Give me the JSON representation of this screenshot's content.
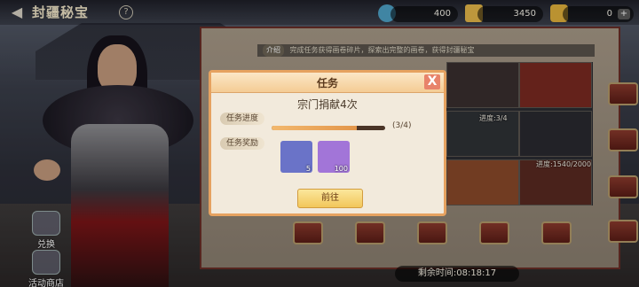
{
  "header": {
    "title": "封疆秘宝",
    "back_icon": "back-arrow-icon",
    "help_label": "?"
  },
  "resources": [
    {
      "name": "silver-coin",
      "value": "400",
      "color": "#4fa3c7"
    },
    {
      "name": "coupon",
      "value": "3450",
      "color": "#e7b94a"
    },
    {
      "name": "gold-ingot",
      "value": "0",
      "color": "#e3b33c",
      "plus": "+"
    }
  ],
  "side_buttons": [
    {
      "label": "兑换",
      "icon": "exchange-icon"
    },
    {
      "label": "活动商店",
      "icon": "shop-icon"
    }
  ],
  "board": {
    "hint_tag": "介绍",
    "hint_text": "完成任务获得画卷碎片，探索出完整的画卷，获得封疆秘宝",
    "progress_a": "进度:3/4",
    "progress_b": "进度:1540/2000",
    "timer": "剩余时间:08:18:17"
  },
  "modal": {
    "title": "任务",
    "task_name": "宗门捐献4次",
    "progress_label": "任务进度",
    "progress_text": "(3/4)",
    "progress_value": 0.75,
    "reward_label": "任务奖励",
    "rewards": [
      {
        "name": "scroll-item",
        "count": "5",
        "color": "#6a73c8"
      },
      {
        "name": "jade-item",
        "count": "100",
        "color": "#a275d8"
      }
    ],
    "go_label": "前往",
    "close_label": "X"
  }
}
